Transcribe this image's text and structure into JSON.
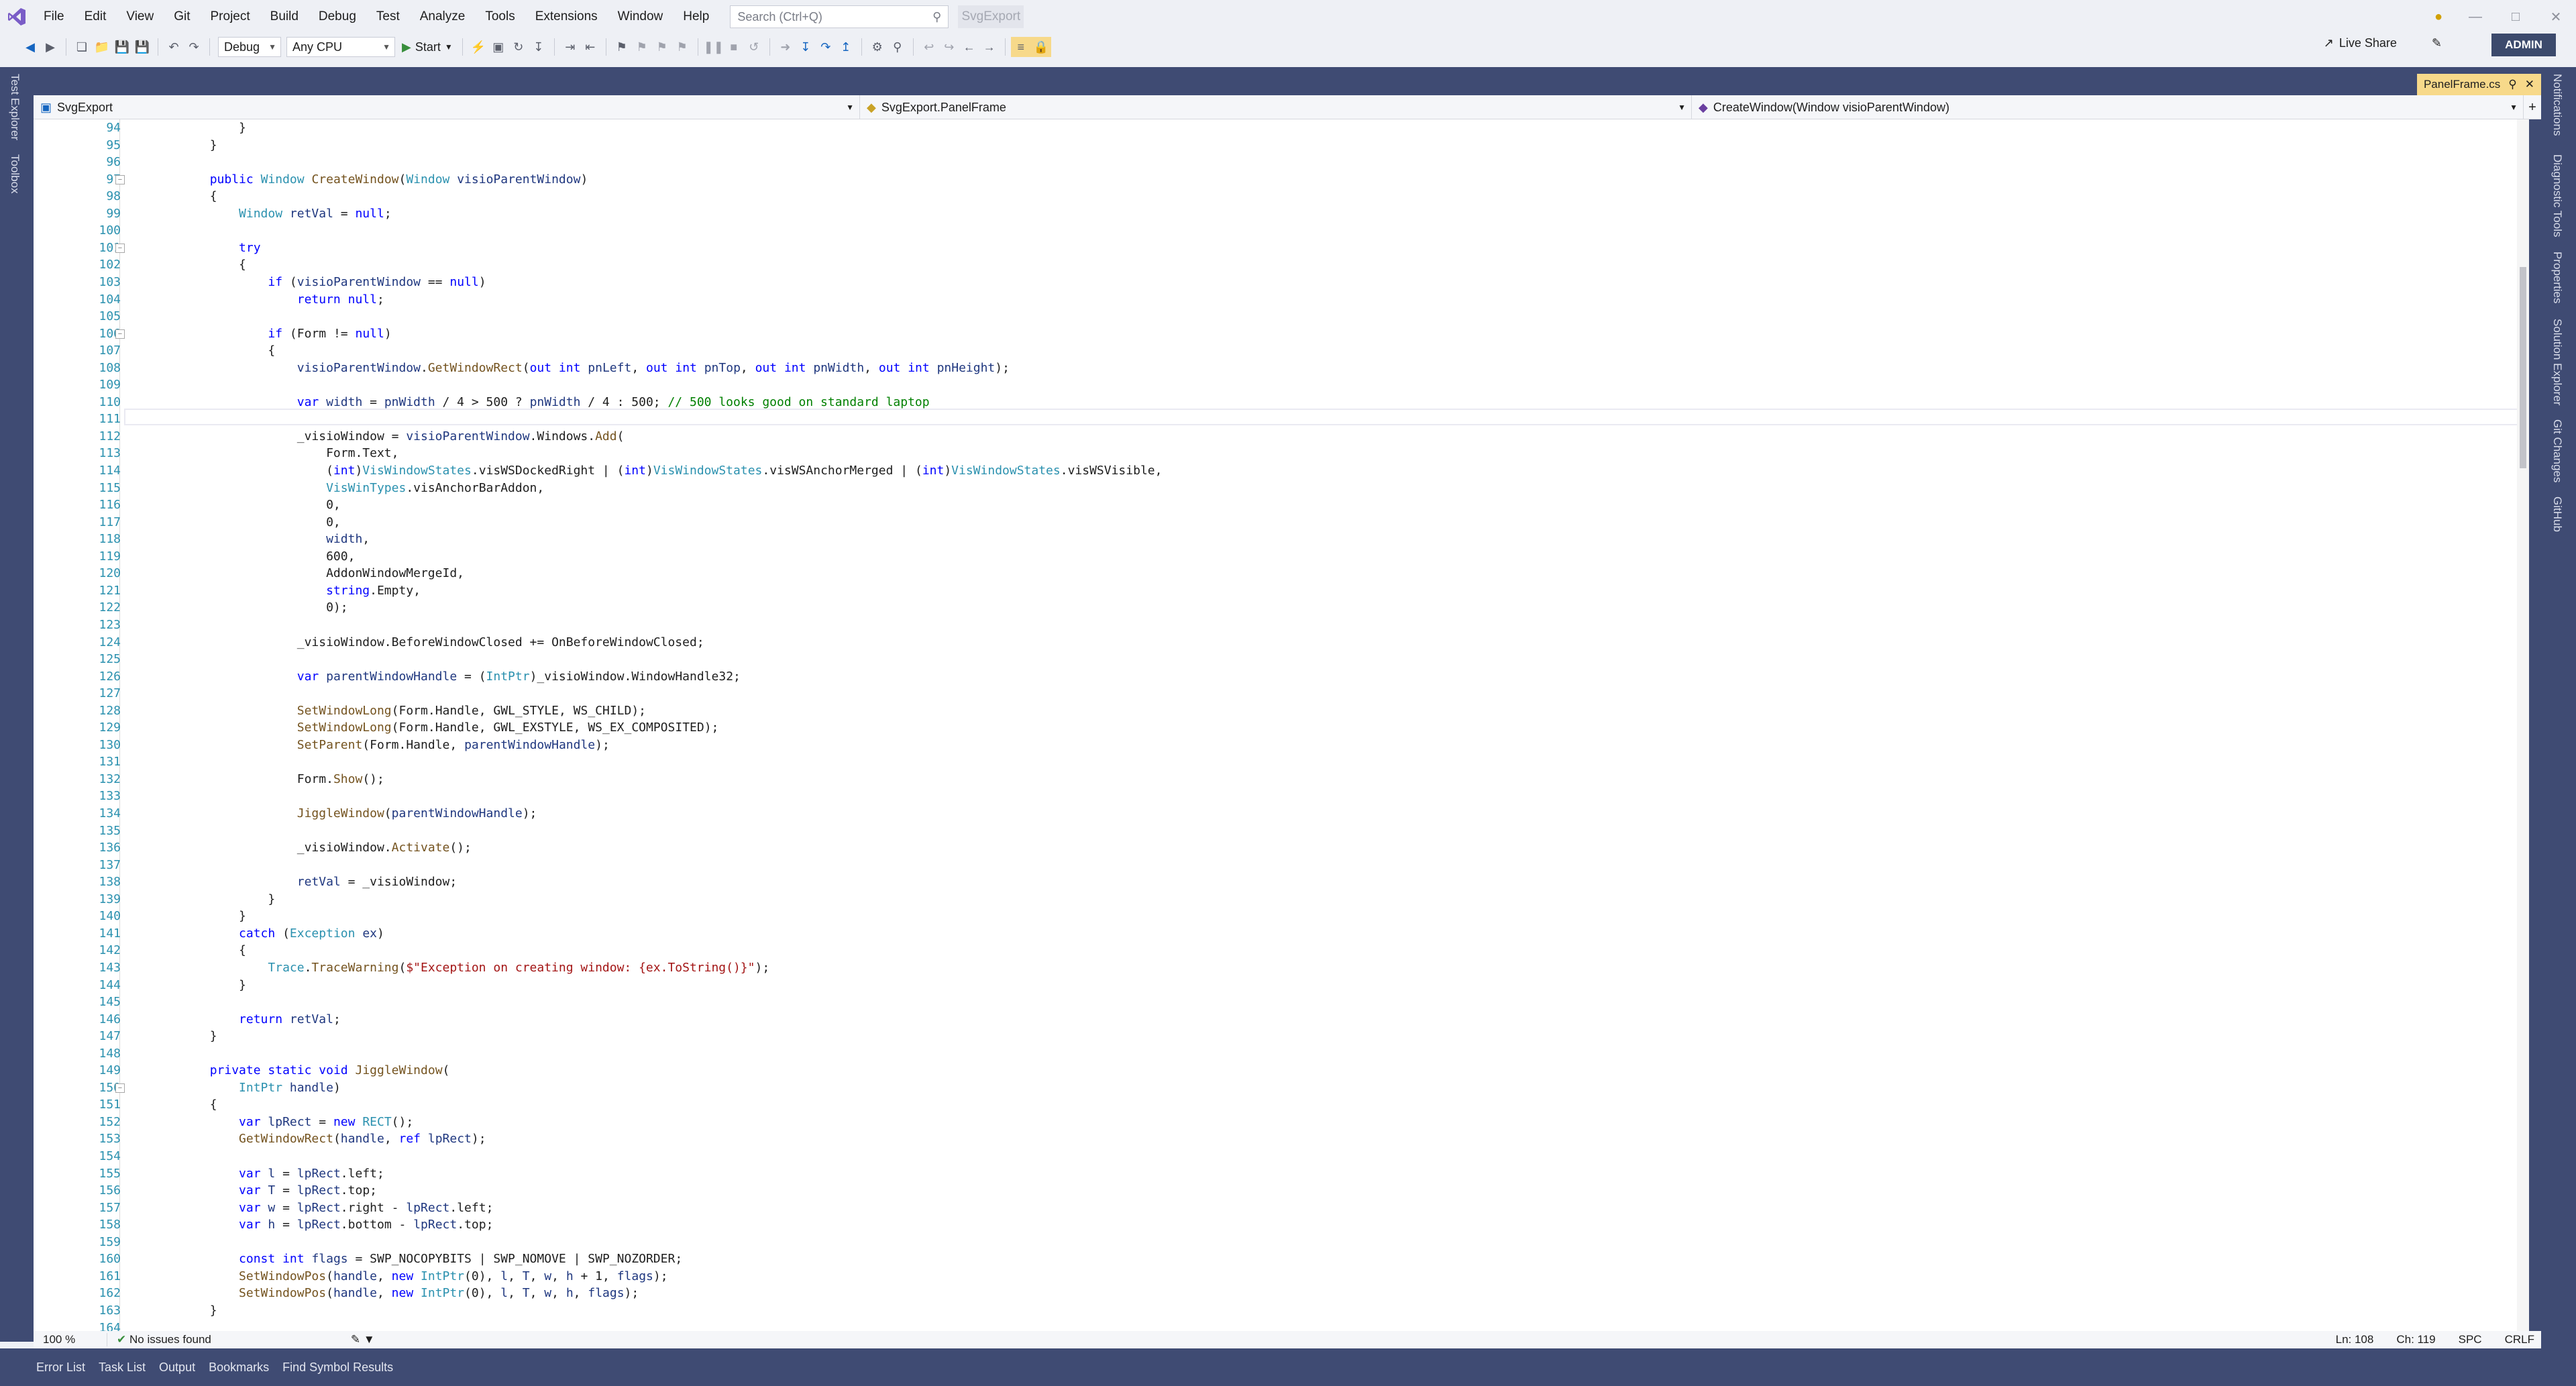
{
  "menu": [
    "File",
    "Edit",
    "View",
    "Git",
    "Project",
    "Build",
    "Debug",
    "Test",
    "Analyze",
    "Tools",
    "Extensions",
    "Window",
    "Help"
  ],
  "search": {
    "placeholder": "Search (Ctrl+Q)"
  },
  "solution_name": "SvgExport",
  "toolbar": {
    "config": "Debug",
    "platform": "Any CPU",
    "start_label": "Start"
  },
  "live_share": "Live Share",
  "user_badge": "ADMIN",
  "left_dock": [
    "Test Explorer",
    "Toolbox"
  ],
  "right_dock": [
    "Notifications",
    "Diagnostic Tools",
    "Properties",
    "Solution Explorer",
    "Git Changes",
    "GitHub"
  ],
  "document_tab": {
    "title": "PanelFrame.cs"
  },
  "navbar": {
    "project": "SvgExport",
    "type": "SvgExport.PanelFrame",
    "member": "CreateWindow(Window visioParentWindow)"
  },
  "editor": {
    "lines": [
      {
        "n": 94,
        "t": "            }"
      },
      {
        "n": 95,
        "t": "        }"
      },
      {
        "n": 96,
        "t": ""
      },
      {
        "n": 97,
        "t": "        public Window CreateWindow(Window visioParentWindow)"
      },
      {
        "n": 98,
        "t": "        {"
      },
      {
        "n": 99,
        "t": "            Window retVal = null;"
      },
      {
        "n": 100,
        "t": ""
      },
      {
        "n": 101,
        "t": "            try"
      },
      {
        "n": 102,
        "t": "            {"
      },
      {
        "n": 103,
        "t": "                if (visioParentWindow == null)"
      },
      {
        "n": 104,
        "t": "                    return null;"
      },
      {
        "n": 105,
        "t": ""
      },
      {
        "n": 106,
        "t": "                if (Form != null)"
      },
      {
        "n": 107,
        "t": "                {"
      },
      {
        "n": 108,
        "t": "                    visioParentWindow.GetWindowRect(out int pnLeft, out int pnTop, out int pnWidth, out int pnHeight);"
      },
      {
        "n": 109,
        "t": ""
      },
      {
        "n": 110,
        "t": "                    var width = pnWidth / 4 > 500 ? pnWidth / 4 : 500; // 500 looks good on standard laptop"
      },
      {
        "n": 111,
        "t": ""
      },
      {
        "n": 112,
        "t": "                    _visioWindow = visioParentWindow.Windows.Add("
      },
      {
        "n": 113,
        "t": "                        Form.Text,"
      },
      {
        "n": 114,
        "t": "                        (int)VisWindowStates.visWSDockedRight | (int)VisWindowStates.visWSAnchorMerged | (int)VisWindowStates.visWSVisible,"
      },
      {
        "n": 115,
        "t": "                        VisWinTypes.visAnchorBarAddon,"
      },
      {
        "n": 116,
        "t": "                        0,"
      },
      {
        "n": 117,
        "t": "                        0,"
      },
      {
        "n": 118,
        "t": "                        width,"
      },
      {
        "n": 119,
        "t": "                        600,"
      },
      {
        "n": 120,
        "t": "                        AddonWindowMergeId,"
      },
      {
        "n": 121,
        "t": "                        string.Empty,"
      },
      {
        "n": 122,
        "t": "                        0);"
      },
      {
        "n": 123,
        "t": ""
      },
      {
        "n": 124,
        "t": "                    _visioWindow.BeforeWindowClosed += OnBeforeWindowClosed;"
      },
      {
        "n": 125,
        "t": ""
      },
      {
        "n": 126,
        "t": "                    var parentWindowHandle = (IntPtr)_visioWindow.WindowHandle32;"
      },
      {
        "n": 127,
        "t": ""
      },
      {
        "n": 128,
        "t": "                    SetWindowLong(Form.Handle, GWL_STYLE, WS_CHILD);"
      },
      {
        "n": 129,
        "t": "                    SetWindowLong(Form.Handle, GWL_EXSTYLE, WS_EX_COMPOSITED);"
      },
      {
        "n": 130,
        "t": "                    SetParent(Form.Handle, parentWindowHandle);"
      },
      {
        "n": 131,
        "t": ""
      },
      {
        "n": 132,
        "t": "                    Form.Show();"
      },
      {
        "n": 133,
        "t": ""
      },
      {
        "n": 134,
        "t": "                    JiggleWindow(parentWindowHandle);"
      },
      {
        "n": 135,
        "t": ""
      },
      {
        "n": 136,
        "t": "                    _visioWindow.Activate();"
      },
      {
        "n": 137,
        "t": ""
      },
      {
        "n": 138,
        "t": "                    retVal = _visioWindow;"
      },
      {
        "n": 139,
        "t": "                }"
      },
      {
        "n": 140,
        "t": "            }"
      },
      {
        "n": 141,
        "t": "            catch (Exception ex)"
      },
      {
        "n": 142,
        "t": "            {"
      },
      {
        "n": 143,
        "t": "                Trace.TraceWarning($\"Exception on creating window: {ex.ToString()}\");"
      },
      {
        "n": 144,
        "t": "            }"
      },
      {
        "n": 145,
        "t": ""
      },
      {
        "n": 146,
        "t": "            return retVal;"
      },
      {
        "n": 147,
        "t": "        }"
      },
      {
        "n": 148,
        "t": ""
      },
      {
        "n": 149,
        "t": "        private static void JiggleWindow("
      },
      {
        "n": 150,
        "t": "            IntPtr handle)"
      },
      {
        "n": 151,
        "t": "        {"
      },
      {
        "n": 152,
        "t": "            var lpRect = new RECT();"
      },
      {
        "n": 153,
        "t": "            GetWindowRect(handle, ref lpRect);"
      },
      {
        "n": 154,
        "t": ""
      },
      {
        "n": 155,
        "t": "            var l = lpRect.left;"
      },
      {
        "n": 156,
        "t": "            var T = lpRect.top;"
      },
      {
        "n": 157,
        "t": "            var w = lpRect.right - lpRect.left;"
      },
      {
        "n": 158,
        "t": "            var h = lpRect.bottom - lpRect.top;"
      },
      {
        "n": 159,
        "t": ""
      },
      {
        "n": 160,
        "t": "            const int flags = SWP_NOCOPYBITS | SWP_NOMOVE | SWP_NOZORDER;"
      },
      {
        "n": 161,
        "t": "            SetWindowPos(handle, new IntPtr(0), l, T, w, h + 1, flags);"
      },
      {
        "n": 162,
        "t": "            SetWindowPos(handle, new IntPtr(0), l, T, w, h, flags);"
      },
      {
        "n": 163,
        "t": "        }"
      },
      {
        "n": 164,
        "t": ""
      }
    ]
  },
  "status": {
    "zoom": "100 %",
    "issues": "No issues found",
    "line": "Ln: 108",
    "col": "Ch: 119",
    "spaces": "SPC",
    "eol": "CRLF"
  },
  "bottom_tabs": [
    "Error List",
    "Task List",
    "Output",
    "Bookmarks",
    "Find Symbol Results"
  ]
}
